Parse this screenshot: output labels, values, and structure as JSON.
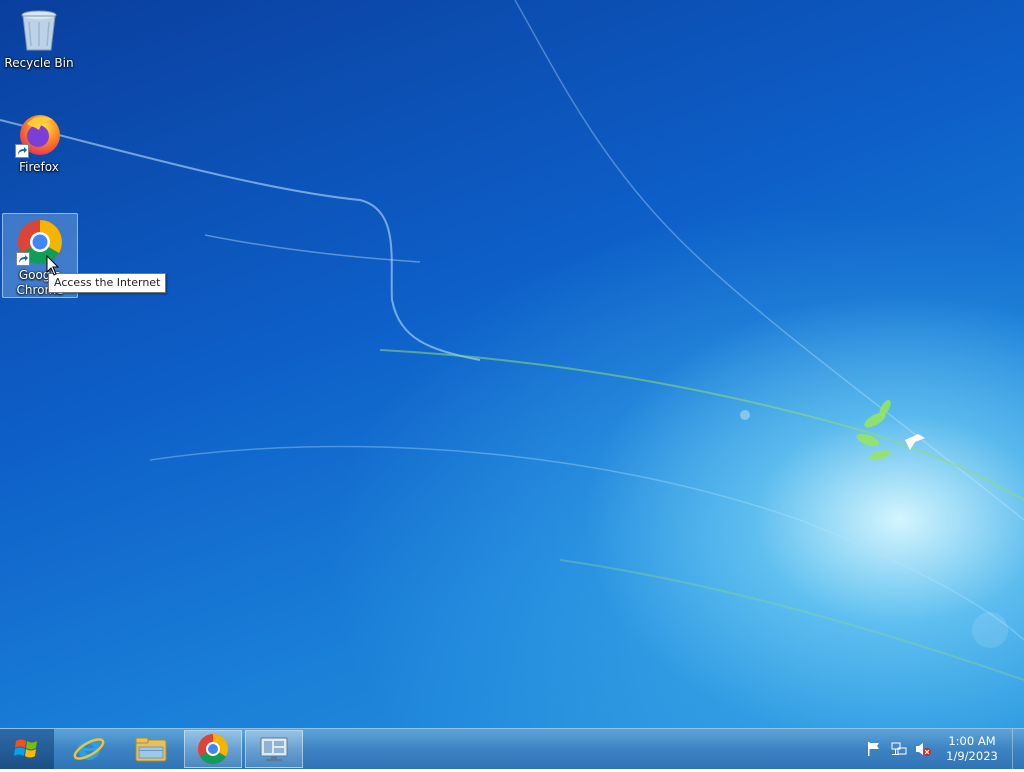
{
  "desktop": {
    "icons": [
      {
        "label": "Recycle Bin",
        "icon": "recycle-bin-icon"
      },
      {
        "label": "Firefox",
        "icon": "firefox-icon"
      },
      {
        "label": "Google Chrome",
        "icon": "chrome-icon",
        "selected": true
      }
    ],
    "tooltip": "Access the Internet"
  },
  "taskbar": {
    "pinned": [
      {
        "name": "Internet Explorer",
        "icon": "internet-explorer-icon"
      },
      {
        "name": "Windows Explorer",
        "icon": "file-explorer-icon"
      },
      {
        "name": "Google Chrome",
        "icon": "chrome-icon",
        "active": true
      },
      {
        "name": "Server Manager",
        "icon": "server-manager-icon"
      }
    ],
    "tray": {
      "icons": [
        "action-center-flag-icon",
        "network-icon",
        "volume-muted-icon"
      ],
      "time": "1:00 AM",
      "date": "1/9/2023"
    }
  },
  "colors": {
    "desktop_top": "#0a3f9e",
    "desktop_glow": "#dcfaff",
    "taskbar": "#3c83c4"
  }
}
